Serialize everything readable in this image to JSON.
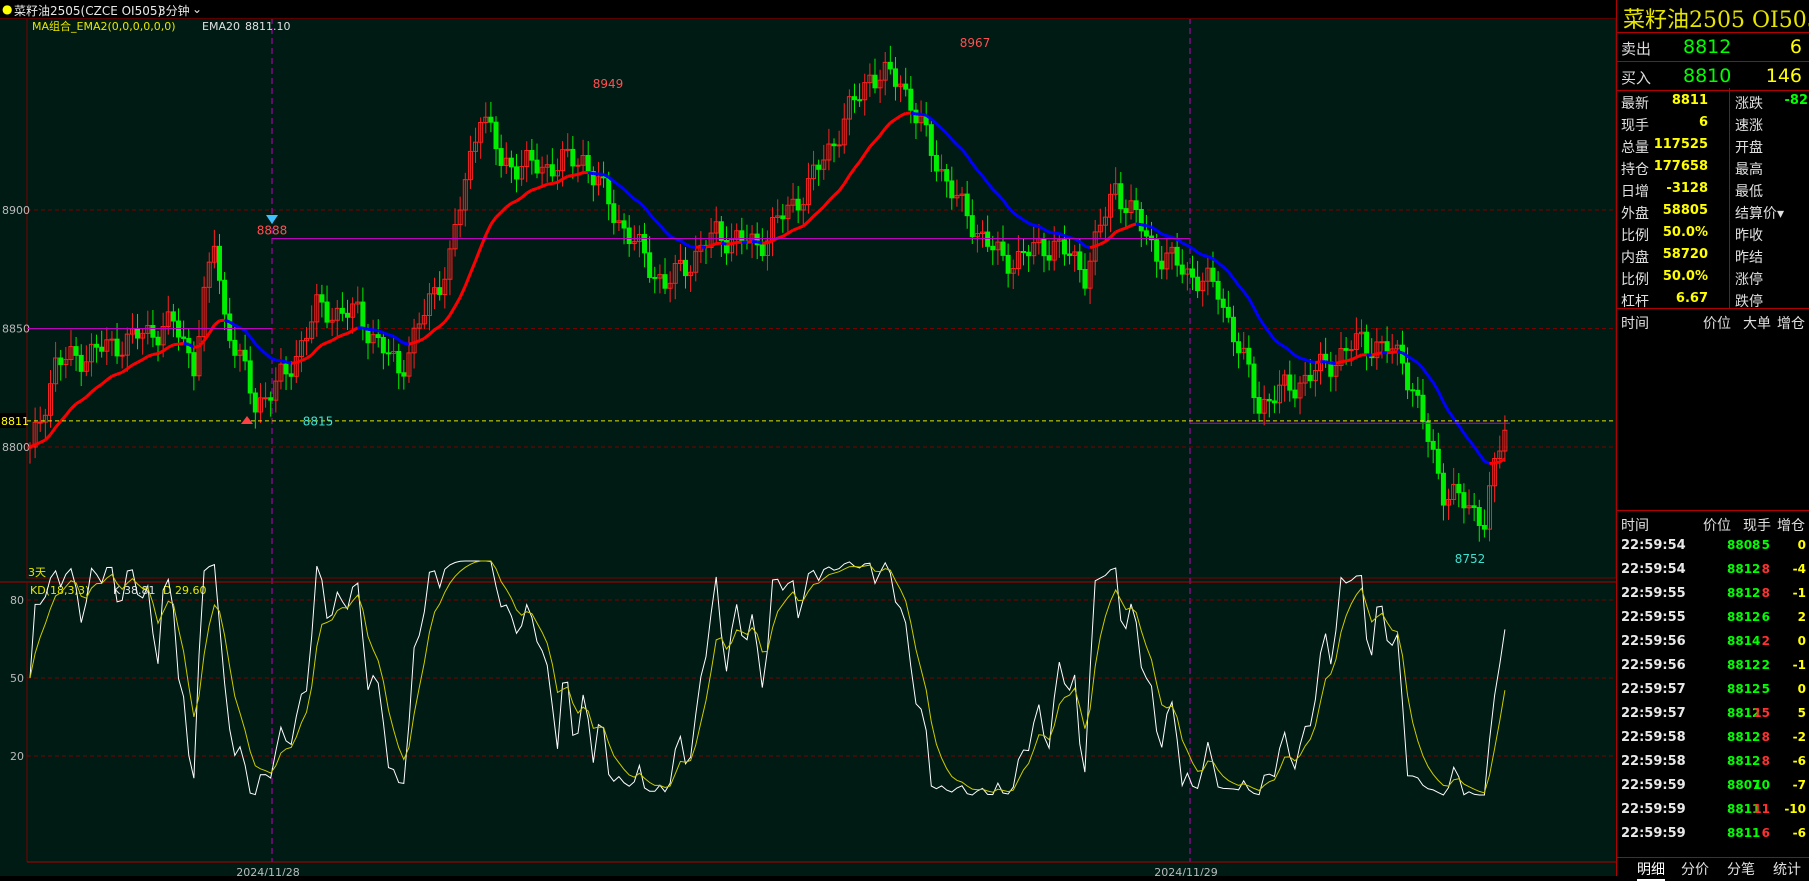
{
  "header": {
    "symbol_title": "菜籽油2505(CZCE OI505)",
    "period": "3分钟",
    "indicator_name": "MA组合_EMA2(0,0,0,0,0,0)",
    "ema_label": "EMA20",
    "ema_value": "8811.10"
  },
  "kd_header": {
    "name": "KD(18,3,3)",
    "k_label": "K",
    "k_value": "38.81",
    "d_label": "D",
    "d_value": "29.60"
  },
  "price_axis": [
    "8900",
    "8850",
    "8800"
  ],
  "current_price_label": "8811",
  "kd_axis": [
    "80",
    "50",
    "20"
  ],
  "annotations": {
    "peak1": "8888",
    "low1": "8815",
    "peak2": "8949",
    "peak3": "8967",
    "low2": "8752",
    "range": "3天"
  },
  "date_labels": [
    "2024/11/28",
    "2024/11/29"
  ],
  "colors": {
    "up_candle": "#ff2020",
    "down_candle": "#00ee00",
    "ema_up": "#ff0000",
    "ema_down": "#0000ff",
    "k_line": "#ffffff",
    "d_line": "#cccc00",
    "grid": "#7a0000",
    "background": "#001a14"
  },
  "panel": {
    "title": "菜籽油2505  OI505",
    "sell_label": "卖出",
    "sell_price": "8812",
    "sell_volume": "6",
    "buy_label": "买入",
    "buy_price": "8810",
    "buy_volume": "146",
    "stats": [
      {
        "l1": "最新",
        "v1": "8811",
        "l2": "涨跌",
        "v2": "-82"
      },
      {
        "l1": "现手",
        "v1": "6",
        "l2": "速涨",
        "v2": ""
      },
      {
        "l1": "总量",
        "v1": "117525",
        "l2": "开盘",
        "v2": ""
      },
      {
        "l1": "持仓",
        "v1": "177658",
        "l2": "最高",
        "v2": ""
      },
      {
        "l1": "日增",
        "v1": "-3128",
        "l2": "最低",
        "v2": ""
      },
      {
        "l1": "外盘",
        "v1": "58805",
        "l2": "结算价▾",
        "v2": ""
      },
      {
        "l1": "比例",
        "v1": "50.0%",
        "l2": "昨收",
        "v2": ""
      },
      {
        "l1": "内盘",
        "v1": "58720",
        "l2": "昨结",
        "v2": ""
      },
      {
        "l1": "比例",
        "v1": "50.0%",
        "l2": "涨停",
        "v2": ""
      },
      {
        "l1": "杠杆",
        "v1": "6.67",
        "l2": "跌停",
        "v2": ""
      }
    ],
    "big_order_header": [
      "时间",
      "价位",
      "大单",
      "增仓"
    ],
    "tick_header": [
      "时间",
      "价位",
      "现手",
      "增仓"
    ],
    "ticks": [
      {
        "t": "22:59:54",
        "p": "8808",
        "q": "5",
        "qc": "#00ff00",
        "d": "0",
        "dc": "#ffff00"
      },
      {
        "t": "22:59:54",
        "p": "8812",
        "q": "8",
        "qc": "#ff3030",
        "d": "-4",
        "dc": "#ffff00"
      },
      {
        "t": "22:59:55",
        "p": "8812",
        "q": "8",
        "qc": "#ff3030",
        "d": "-1",
        "dc": "#ffff00"
      },
      {
        "t": "22:59:55",
        "p": "8812",
        "q": "6",
        "qc": "#00ff00",
        "d": "2",
        "dc": "#ffff00"
      },
      {
        "t": "22:59:56",
        "p": "8814",
        "q": "2",
        "qc": "#ff3030",
        "d": "0",
        "dc": "#ffff00"
      },
      {
        "t": "22:59:56",
        "p": "8812",
        "q": "2",
        "qc": "#00ff00",
        "d": "-1",
        "dc": "#ffff00"
      },
      {
        "t": "22:59:57",
        "p": "8812",
        "q": "5",
        "qc": "#00ff00",
        "d": "0",
        "dc": "#ffff00"
      },
      {
        "t": "22:59:57",
        "p": "8812",
        "q": "15",
        "qc": "#ff3030",
        "d": "5",
        "dc": "#ffff00"
      },
      {
        "t": "22:59:58",
        "p": "8812",
        "q": "8",
        "qc": "#ff3030",
        "d": "-2",
        "dc": "#ffff00"
      },
      {
        "t": "22:59:58",
        "p": "8812",
        "q": "8",
        "qc": "#ff3030",
        "d": "-6",
        "dc": "#ffff00"
      },
      {
        "t": "22:59:59",
        "p": "8807",
        "q": "10",
        "qc": "#00ff00",
        "d": "-7",
        "dc": "#ffff00"
      },
      {
        "t": "22:59:59",
        "p": "8811",
        "q": "11",
        "qc": "#ff3030",
        "d": "-10",
        "dc": "#ffff00"
      },
      {
        "t": "22:59:59",
        "p": "8811",
        "q": "6",
        "qc": "#ff3030",
        "d": "-6",
        "dc": "#ffff00"
      }
    ],
    "tabs": [
      "明细",
      "分价",
      "分笔",
      "统计"
    ]
  }
}
